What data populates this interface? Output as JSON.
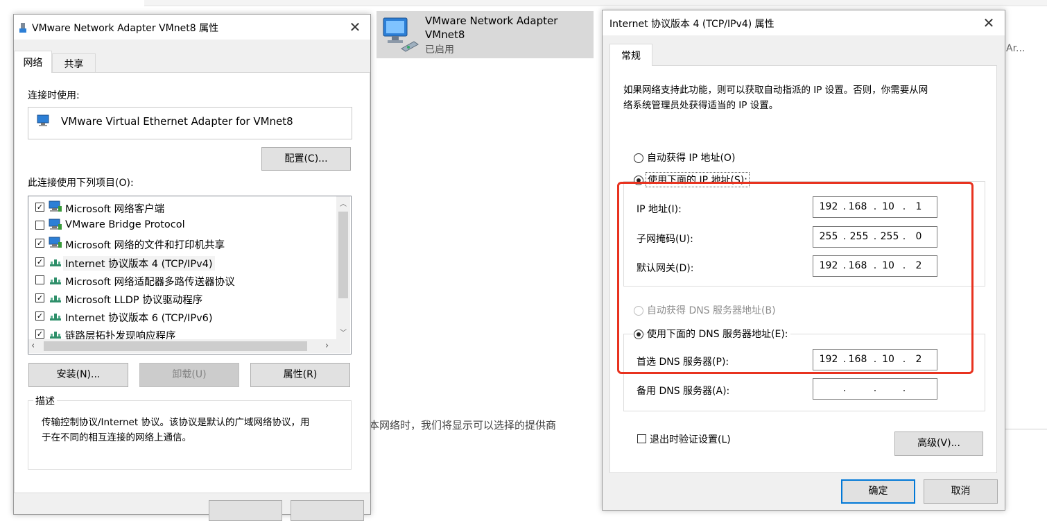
{
  "background": {
    "adapter_name": "VMware Network Adapter VMnet8",
    "adapter_status": "已启用",
    "right_fragment": "Ar...",
    "obscured_text": "本网络时，我们将显示可以选择的提供商"
  },
  "left_dialog": {
    "title": "VMware Network Adapter VMnet8 属性",
    "tabs": [
      "网络",
      "共享"
    ],
    "connect_using_label": "连接时使用:",
    "adapter": "VMware Virtual Ethernet Adapter for VMnet8",
    "configure_button": "配置(C)...",
    "items_label": "此连接使用下列项目(O):",
    "items": [
      {
        "label": "Microsoft 网络客户端",
        "checked": true,
        "icon": "network-client-icon"
      },
      {
        "label": "VMware Bridge Protocol",
        "checked": false,
        "icon": "network-client-icon"
      },
      {
        "label": "Microsoft 网络的文件和打印机共享",
        "checked": true,
        "icon": "network-client-icon"
      },
      {
        "label": "Internet 协议版本 4 (TCP/IPv4)",
        "checked": true,
        "icon": "protocol-icon"
      },
      {
        "label": "Microsoft 网络适配器多路传送器协议",
        "checked": false,
        "icon": "protocol-icon"
      },
      {
        "label": "Microsoft LLDP 协议驱动程序",
        "checked": true,
        "icon": "protocol-icon"
      },
      {
        "label": "Internet 协议版本 6 (TCP/IPv6)",
        "checked": true,
        "icon": "protocol-icon"
      },
      {
        "label": "链路层拓扑发现响应程序",
        "checked": true,
        "icon": "protocol-icon"
      }
    ],
    "install_button": "安装(N)...",
    "uninstall_button": "卸载(U)",
    "properties_button": "属性(R)",
    "description_label": "描述",
    "description_text_line1": "传输控制协议/Internet 协议。该协议是默认的广域网络协议，用",
    "description_text_line2": "于在不同的相互连接的网络上通信。"
  },
  "right_dialog": {
    "title": "Internet 协议版本 4 (TCP/IPv4) 属性",
    "tab": "常规",
    "intro_line1": "如果网络支持此功能，则可以获取自动指派的 IP 设置。否则，你需要从网",
    "intro_line2": "络系统管理员处获得适当的 IP 设置。",
    "auto_ip_option": "自动获得 IP 地址(O)",
    "manual_ip_option": "使用下面的 IP 地址(S):",
    "ip_label": "IP 地址(I):",
    "ip_value": [
      "192",
      "168",
      "10",
      "1"
    ],
    "subnet_label": "子网掩码(U):",
    "subnet_value": [
      "255",
      "255",
      "255",
      "0"
    ],
    "gateway_label": "默认网关(D):",
    "gateway_value": [
      "192",
      "168",
      "10",
      "2"
    ],
    "auto_dns_option": "自动获得 DNS 服务器地址(B)",
    "manual_dns_option": "使用下面的 DNS 服务器地址(E):",
    "preferred_dns_label": "首选 DNS 服务器(P):",
    "preferred_dns_value": [
      "192",
      "168",
      "10",
      "2"
    ],
    "alternate_dns_label": "备用 DNS 服务器(A):",
    "alternate_dns_value": [
      "",
      "",
      "",
      ""
    ],
    "validate_on_exit": "退出时验证设置(L)",
    "advanced_button": "高级(V)...",
    "ok_button": "确定",
    "cancel_button": "取消"
  },
  "colors": {
    "highlight_box": "#e8321f",
    "default_button_border": "#0078d7",
    "dialog_bg": "#f0f0f0"
  }
}
